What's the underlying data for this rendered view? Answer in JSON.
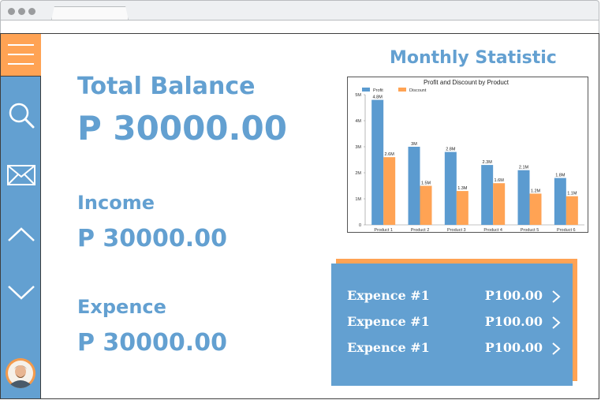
{
  "summary": {
    "total_balance_label": "Total Balance",
    "total_balance_value": "P 30000.00",
    "income_label": "Income",
    "income_value": "P 30000.00",
    "expence_label": "Expence",
    "expence_value": "P 30000.00"
  },
  "statistic": {
    "title": "Monthly Statistic"
  },
  "chart_data": {
    "type": "bar",
    "title": "Profit and Discount by Product",
    "categories": [
      "Product 1",
      "Product 2",
      "Product 3",
      "Product 4",
      "Product 5",
      "Product 6"
    ],
    "series": [
      {
        "name": "Profit",
        "values": [
          4.8,
          3.0,
          2.8,
          2.3,
          2.1,
          1.8
        ],
        "labels": [
          "4.8M",
          "3M",
          "2.8M",
          "2.3M",
          "2.1M",
          "1.8M"
        ],
        "color": "#5b9bd0"
      },
      {
        "name": "Discount",
        "values": [
          2.6,
          1.5,
          1.3,
          1.6,
          1.2,
          1.1
        ],
        "labels": [
          "2.6M",
          "1.5M",
          "1.3M",
          "1.6M",
          "1.2M",
          "1.1M"
        ],
        "color": "#ffa354"
      }
    ],
    "yticks": [
      "0",
      "1M",
      "2M",
      "3M",
      "4M",
      "5M"
    ],
    "ylim": [
      0,
      5
    ],
    "legend": "top-left",
    "grid": false
  },
  "expenses": [
    {
      "name": "Expence #1",
      "amount": "P100.00"
    },
    {
      "name": "Expence #1",
      "amount": "P100.00"
    },
    {
      "name": "Expence #1",
      "amount": "P100.00"
    }
  ],
  "colors": {
    "accent_blue": "#63a0d1",
    "accent_orange": "#ffa354"
  },
  "icons": {
    "menu": "hamburger-icon",
    "search": "search-icon",
    "mail": "mail-icon",
    "up": "chevron-up-icon",
    "down": "chevron-down-icon"
  }
}
